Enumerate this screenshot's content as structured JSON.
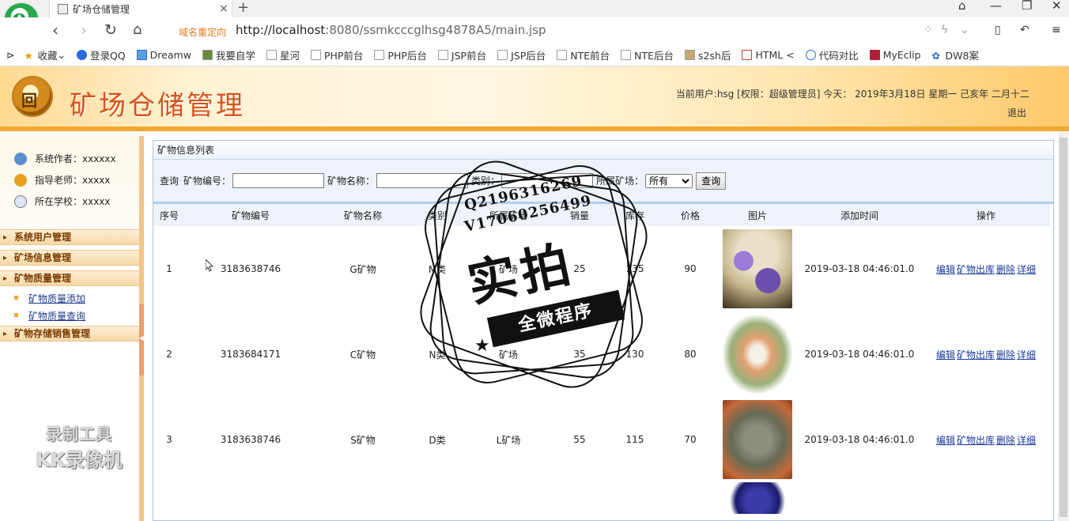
{
  "browser": {
    "tab_title": "矿场仓储管理",
    "tab_close": "×",
    "new_tab": "+",
    "redirect_tag": "域名重定向",
    "url_host": "http://localhost",
    "url_rest": ":8080/ssmkcccglhsg4878A5/main.jsp",
    "bookmarks": [
      "收藏",
      "登录QQ",
      "Dreamw",
      "我要自学",
      "星河",
      "PHP前台",
      "PHP后台",
      "JSP前台",
      "JSP后台",
      "NTE前台",
      "NTE后台",
      "s2sh后",
      "HTML <",
      "代码对比",
      "MyEclip",
      "DW8案"
    ]
  },
  "header": {
    "logo_glyph": "回",
    "title": "矿场仓储管理",
    "user_info": "当前用户:hsg [权限：超级管理员] 今天： 2019年3月18日 星期一 己亥年 二月十二",
    "logout": "退出"
  },
  "sidebar": {
    "info": [
      {
        "label": "系统作者：xxxxxx"
      },
      {
        "label": "指导老师：xxxxx"
      },
      {
        "label": "所在学校：xxxxx"
      }
    ],
    "menus": [
      "系统用户管理",
      "矿场信息管理",
      "矿物质量管理"
    ],
    "submenus": [
      "矿物质量添加",
      "矿物质量查询"
    ],
    "menu_last": "矿物存储销售管理",
    "collapse": "◀"
  },
  "watermark": {
    "line1": "录制工具",
    "line2": "KK录像机"
  },
  "main": {
    "panel_title": "矿物信息列表",
    "search": {
      "query_label": "查询",
      "code_label": "矿物编号：",
      "name_label": "矿物名称：",
      "type_label": "类别：",
      "site_label": "所属矿场：",
      "site_selected": "所有",
      "button": "查询"
    },
    "columns": [
      "序号",
      "矿物编号",
      "矿物名称",
      "类别",
      "所属矿场",
      "销量",
      "库存",
      "价格",
      "图片",
      "添加时间",
      "操作"
    ],
    "actions": [
      "编辑",
      "矿物出库",
      "删除",
      "详细"
    ],
    "rows": [
      {
        "no": "1",
        "code": "3183638746",
        "name": "G矿物",
        "type": "M类",
        "site": "矿场",
        "sales": "25",
        "stock": "135",
        "price": "90",
        "time": "2019-03-18 04:46:01.0"
      },
      {
        "no": "2",
        "code": "3183684171",
        "name": "C矿物",
        "type": "N类",
        "site": "矿场",
        "sales": "35",
        "stock": "130",
        "price": "80",
        "time": "2019-03-18 04:46:01.0"
      },
      {
        "no": "3",
        "code": "3183638746",
        "name": "S矿物",
        "type": "D类",
        "site": "L矿场",
        "sales": "55",
        "stock": "115",
        "price": "70",
        "time": "2019-03-18 04:46:01.0"
      }
    ]
  },
  "stamp": {
    "line1": "Q2196316269",
    "line2": "V17060256499",
    "big": "实拍",
    "ribbon": "全微程序"
  }
}
